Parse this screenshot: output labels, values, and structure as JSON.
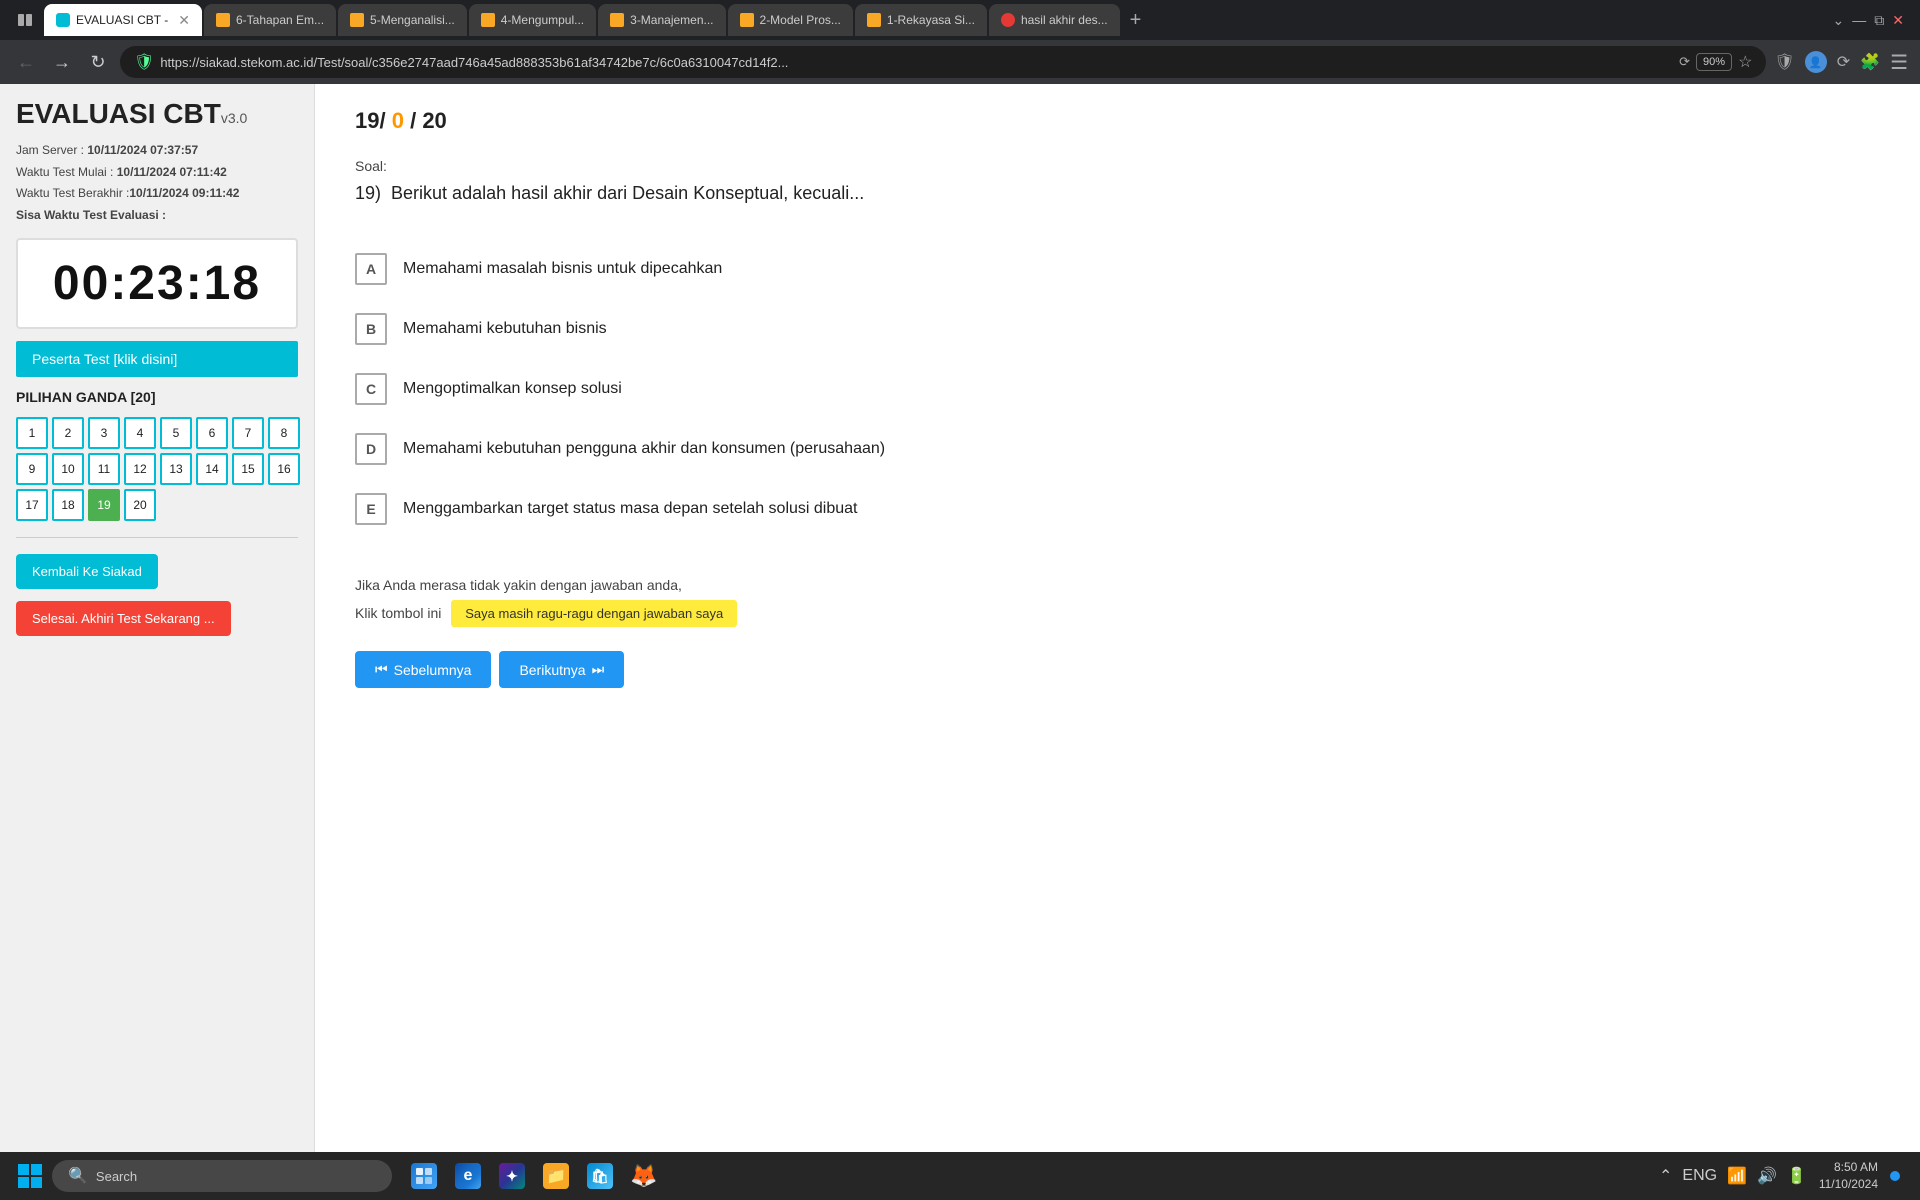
{
  "browser": {
    "tabs": [
      {
        "id": "tab1",
        "label": "EVALUASI CBT -",
        "active": true,
        "color": "#00bcd4"
      },
      {
        "id": "tab2",
        "label": "6-Tahapan Em...",
        "active": false,
        "color": "#f9a825"
      },
      {
        "id": "tab3",
        "label": "5-Menganalisi...",
        "active": false,
        "color": "#f9a825"
      },
      {
        "id": "tab4",
        "label": "4-Mengumpul...",
        "active": false,
        "color": "#f9a825"
      },
      {
        "id": "tab5",
        "label": "3-Manajemen...",
        "active": false,
        "color": "#f9a825"
      },
      {
        "id": "tab6",
        "label": "2-Model Pros...",
        "active": false,
        "color": "#f9a825"
      },
      {
        "id": "tab7",
        "label": "1-Rekayasa Si...",
        "active": false,
        "color": "#f9a825"
      },
      {
        "id": "tab8",
        "label": "hasil akhir des...",
        "active": false,
        "color": "#e53935"
      }
    ],
    "url": "https://siakad.stekom.ac.id/Test/soal/c356e2747aad746a45ad888353b61af34742be7c/6c0a6310047cd14f2...",
    "zoom": "90%"
  },
  "sidebar": {
    "title": "EVALUASI CBT",
    "version": "v3.0",
    "jam_server_label": "Jam Server :",
    "jam_server_value": "10/11/2024 07:37:57",
    "waktu_mulai_label": "Waktu Test Mulai :",
    "waktu_mulai_value": "10/11/2024 07:11:42",
    "waktu_berakhir_label": "Waktu Test Berakhir :",
    "waktu_berakhir_value": "10/11/2024 09:11:42",
    "sisa_waktu_label": "Sisa Waktu Test Evaluasi :",
    "timer": "00:23:18",
    "peserta_btn": "Peserta Test [klik disini]",
    "pilihan_ganda_label": "PILIHAN GANDA [20]",
    "questions": [
      1,
      2,
      3,
      4,
      5,
      6,
      7,
      8,
      9,
      10,
      11,
      12,
      13,
      14,
      15,
      16,
      17,
      18,
      19,
      20
    ],
    "current_question": 19,
    "kembali_btn": "Kembali Ke Siakad",
    "selesai_btn": "Selesai. Akhiri Test Sekarang ..."
  },
  "main": {
    "counter_answered": "19",
    "counter_flagged": "0",
    "counter_total": "20",
    "soal_label": "Soal:",
    "question_number": "19)",
    "question_text": "Berikut adalah hasil akhir dari Desain Konseptual, kecuali...",
    "options": [
      {
        "key": "A",
        "text": "Memahami masalah bisnis untuk dipecahkan"
      },
      {
        "key": "B",
        "text": "Memahami kebutuhan bisnis"
      },
      {
        "key": "C",
        "text": "Mengoptimalkan konsep solusi"
      },
      {
        "key": "D",
        "text": "Memahami kebutuhan pengguna akhir dan konsumen (perusahaan)"
      },
      {
        "key": "E",
        "text": "Menggambarkan target status masa depan setelah solusi dibuat"
      }
    ],
    "uncertainty_text1": "Jika Anda merasa tidak yakin dengan jawaban anda,",
    "uncertainty_text2": "Klik tombol ini",
    "ragu_btn": "Saya masih ragu-ragu dengan jawaban saya",
    "prev_btn": "Sebelumnya",
    "next_btn": "Berikutnya"
  },
  "taskbar": {
    "search_placeholder": "Search",
    "time": "8:50 AM",
    "date": "11/10/2024",
    "lang": "ENG"
  }
}
